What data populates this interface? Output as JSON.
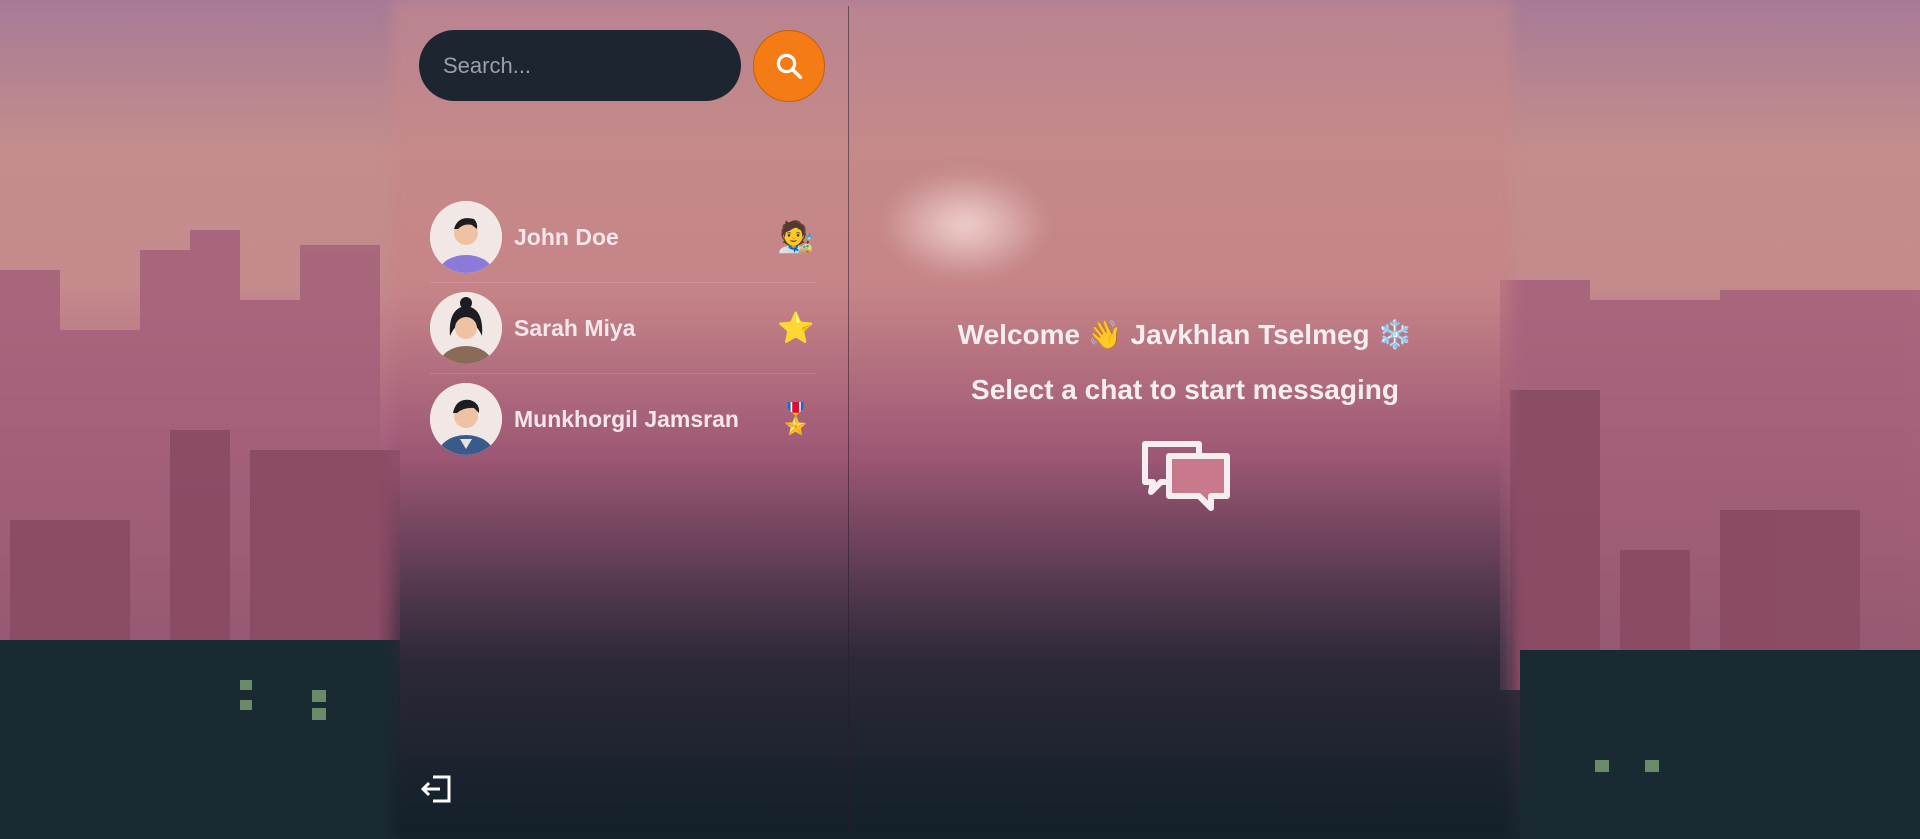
{
  "search": {
    "placeholder": "Search..."
  },
  "icons": {
    "search": "search-icon",
    "logout": "logout-icon",
    "chat": "chat-bubbles-icon"
  },
  "colors": {
    "accent": "#f57c14",
    "search_bg": "#1d2530",
    "text": "#f4e6ea"
  },
  "contacts": [
    {
      "name": "John Doe",
      "emoji": "🧑‍🎨",
      "avatar": "man-avatar"
    },
    {
      "name": "Sarah Miya",
      "emoji": "⭐",
      "avatar": "woman-avatar"
    },
    {
      "name": "Munkhorgil Jamsran",
      "emoji": "🎖️",
      "avatar": "man-jacket-avatar"
    }
  ],
  "welcome": {
    "greeting": "Welcome 👋 Javkhlan Tselmeg ❄️",
    "subtitle": "Select a chat to start messaging"
  }
}
